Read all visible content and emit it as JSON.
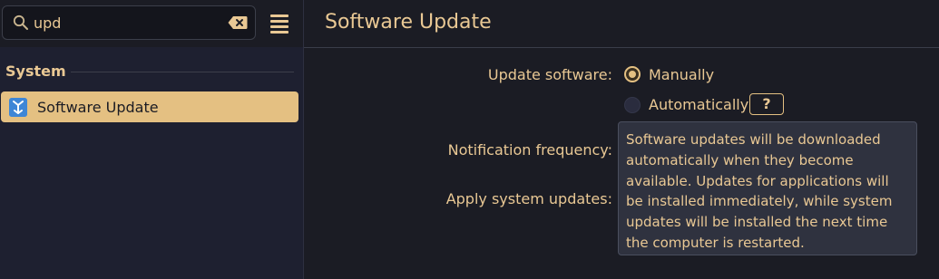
{
  "search": {
    "value": "upd"
  },
  "sidebar": {
    "section": "System",
    "items": [
      {
        "label": "Software Update",
        "selected": true
      }
    ]
  },
  "header": {
    "title": "Software Update"
  },
  "form": {
    "update_software": {
      "label": "Update software:",
      "options": [
        {
          "label": "Manually",
          "checked": true
        },
        {
          "label": "Automatically",
          "checked": false
        }
      ],
      "help_label": "?"
    },
    "notification_frequency": {
      "label": "Notification frequency:"
    },
    "apply_system_updates": {
      "label": "Apply system updates:"
    }
  },
  "tooltip": {
    "text": "Software updates will be downloaded automatically when they become available. Updates for applications will be installed immediately, while system updates will be installed the next time the computer is restarted."
  },
  "colors": {
    "accent": "#e4c082",
    "background": "#1b1c24",
    "sidebar_background": "#1e2030",
    "tooltip_background": "#2f323f"
  },
  "icons": [
    "search-icon",
    "backspace-clear-icon",
    "hamburger-menu-icon",
    "software-update-app-icon",
    "help-icon"
  ]
}
